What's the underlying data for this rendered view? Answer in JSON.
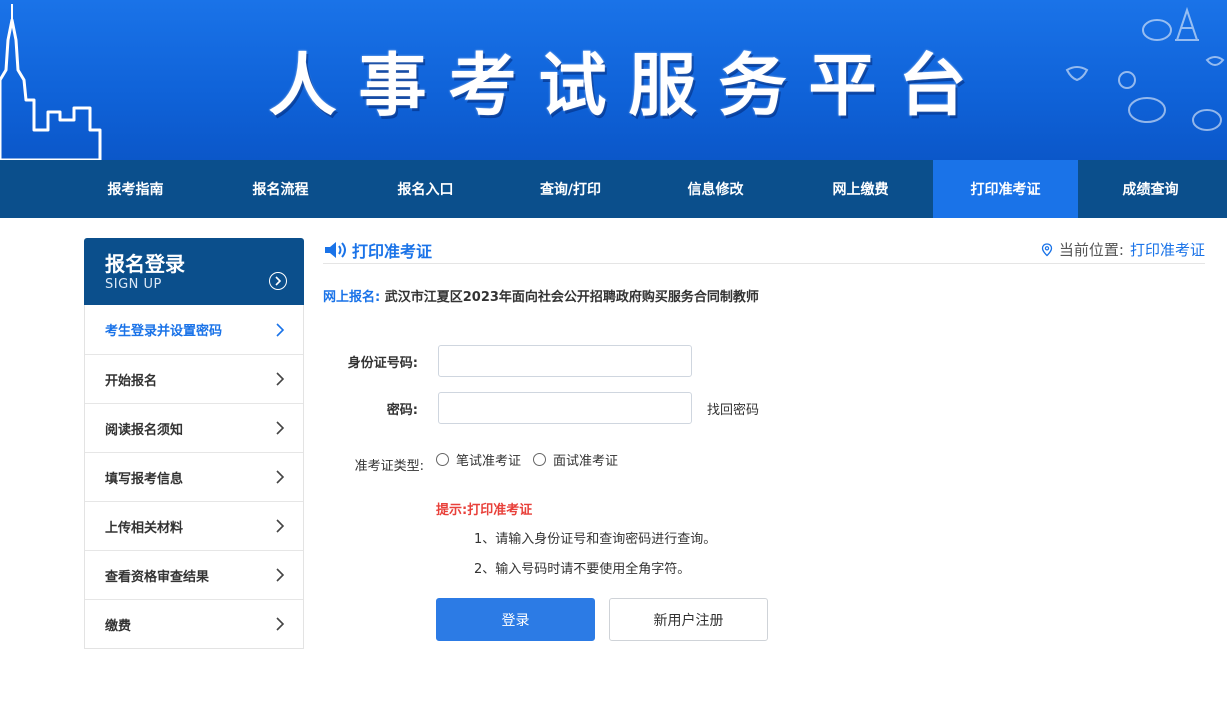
{
  "banner": {
    "title": "人事考试服务平台"
  },
  "nav": {
    "items": [
      {
        "label": "报考指南"
      },
      {
        "label": "报名流程"
      },
      {
        "label": "报名入口"
      },
      {
        "label": "查询/打印"
      },
      {
        "label": "信息修改"
      },
      {
        "label": "网上缴费"
      },
      {
        "label": "打印准考证",
        "active": true
      },
      {
        "label": "成绩查询"
      }
    ]
  },
  "sidebar": {
    "title": "报名登录",
    "subtitle": "SIGN UP",
    "items": [
      {
        "label": "考生登录并设置密码",
        "active": true
      },
      {
        "label": "开始报名"
      },
      {
        "label": "阅读报名须知"
      },
      {
        "label": "填写报考信息"
      },
      {
        "label": "上传相关材料"
      },
      {
        "label": "查看资格审查结果"
      },
      {
        "label": "缴费"
      }
    ]
  },
  "content": {
    "title": "打印准考证",
    "location_label": "当前位置:",
    "location_value": "打印准考证",
    "exam_label": "网上报名:",
    "exam_name": "武汉市江夏区2023年面向社会公开招聘政府购买服务合同制教师"
  },
  "form": {
    "id_label": "身份证号码:",
    "id_value": "",
    "password_label": "密码:",
    "password_value": "",
    "forgot_link": "找回密码",
    "type_label": "准考证类型:",
    "type_options": [
      "笔试准考证",
      "面试准考证"
    ]
  },
  "tips": {
    "title": "提示:打印准考证",
    "lines": [
      "1、请输入身份证号和查询密码进行查询。",
      "2、输入号码时请不要使用全角字符。"
    ]
  },
  "buttons": {
    "login": "登录",
    "register": "新用户注册"
  },
  "colors": {
    "banner": "#1a73e8",
    "nav": "#0b4f8c",
    "nav_active": "#1a73e8",
    "accent": "#1a73e8",
    "tip": "#e8403a",
    "button": "#2c7be5"
  }
}
